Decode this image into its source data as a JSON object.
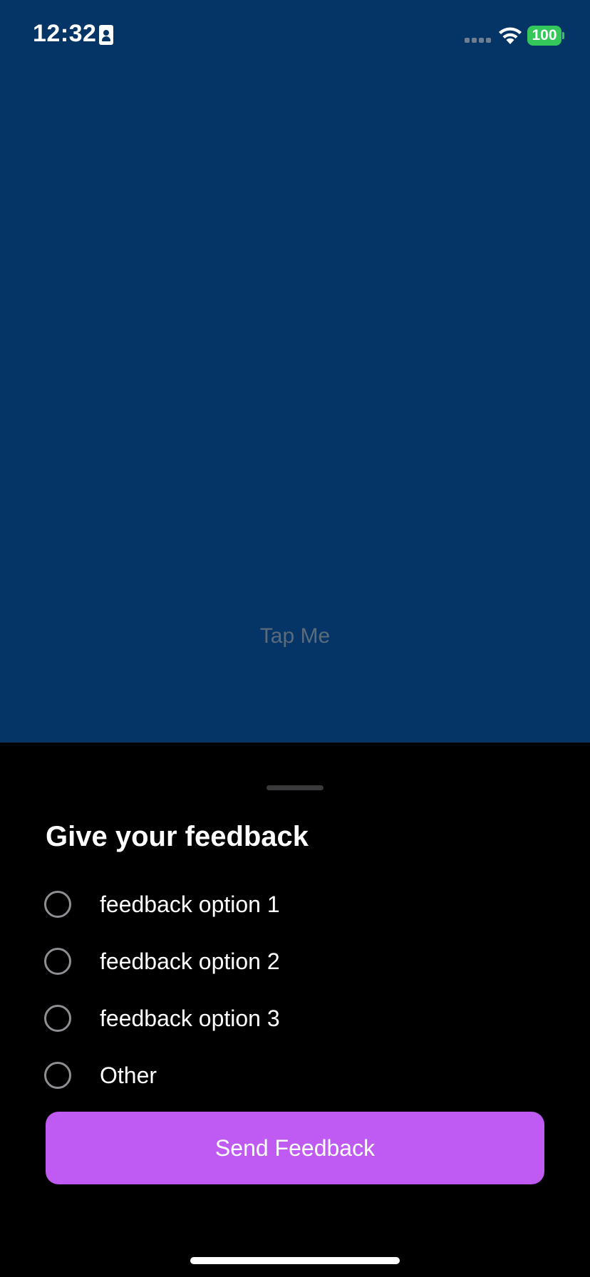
{
  "status_bar": {
    "time": "12:32",
    "battery_level": "100",
    "icons": [
      "contact-card-icon",
      "cellular-signal-icon",
      "wifi-icon",
      "battery-icon"
    ]
  },
  "main": {
    "background_color": "#053566",
    "tap_button_label": "Tap Me"
  },
  "sheet": {
    "title": "Give your feedback",
    "options": [
      {
        "label": "feedback option 1",
        "selected": false
      },
      {
        "label": "feedback option 2",
        "selected": false
      },
      {
        "label": "feedback option 3",
        "selected": false
      },
      {
        "label": "Other",
        "selected": false
      }
    ],
    "submit_label": "Send Feedback",
    "accent_color": "#bf5af2"
  }
}
